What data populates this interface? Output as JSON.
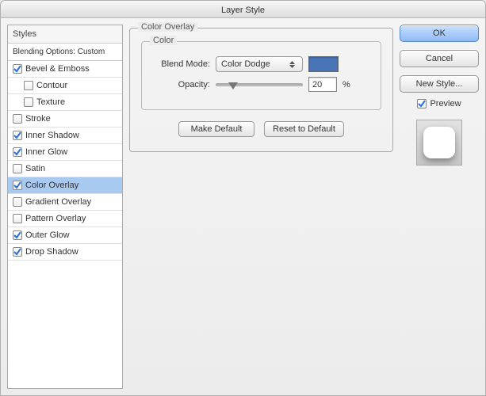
{
  "window": {
    "title": "Layer Style"
  },
  "left": {
    "header": "Styles",
    "blending": "Blending Options: Custom",
    "items": [
      {
        "label": "Bevel & Emboss",
        "checked": true,
        "sub": false
      },
      {
        "label": "Contour",
        "checked": false,
        "sub": true
      },
      {
        "label": "Texture",
        "checked": false,
        "sub": true
      },
      {
        "label": "Stroke",
        "checked": false,
        "sub": false
      },
      {
        "label": "Inner Shadow",
        "checked": true,
        "sub": false
      },
      {
        "label": "Inner Glow",
        "checked": true,
        "sub": false
      },
      {
        "label": "Satin",
        "checked": false,
        "sub": false
      },
      {
        "label": "Color Overlay",
        "checked": true,
        "sub": false,
        "selected": true
      },
      {
        "label": "Gradient Overlay",
        "checked": false,
        "sub": false
      },
      {
        "label": "Pattern Overlay",
        "checked": false,
        "sub": false
      },
      {
        "label": "Outer Glow",
        "checked": true,
        "sub": false
      },
      {
        "label": "Drop Shadow",
        "checked": true,
        "sub": false
      }
    ]
  },
  "main": {
    "group_title": "Color Overlay",
    "color_title": "Color",
    "blend_mode_label": "Blend Mode:",
    "blend_mode_value": "Color Dodge",
    "swatch_color": "#4a74b8",
    "opacity_label": "Opacity:",
    "opacity_value": "20",
    "opacity_suffix": "%",
    "make_default": "Make Default",
    "reset_default": "Reset to Default"
  },
  "right": {
    "ok": "OK",
    "cancel": "Cancel",
    "new_style": "New Style...",
    "preview_label": "Preview"
  }
}
